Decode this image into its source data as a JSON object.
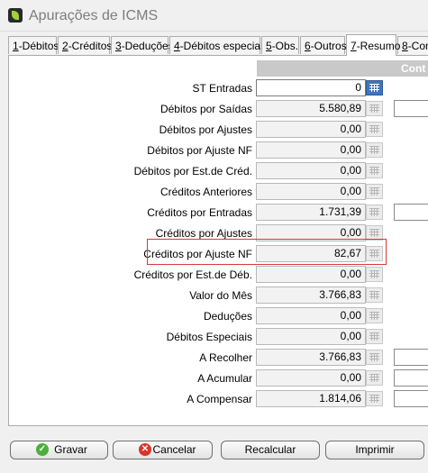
{
  "window": {
    "title": "Apurações de ICMS"
  },
  "tabs": [
    {
      "hotkey": "1",
      "label": "-Débitos"
    },
    {
      "hotkey": "2",
      "label": "-Créditos"
    },
    {
      "hotkey": "3",
      "label": "-Deduções"
    },
    {
      "hotkey": "4",
      "label": "-Débitos especiais"
    },
    {
      "hotkey": "5",
      "label": "-Obs."
    },
    {
      "hotkey": "6",
      "label": "-Outros"
    },
    {
      "hotkey": "7",
      "label": "-Resumo"
    },
    {
      "hotkey": "8",
      "label": "-Con"
    }
  ],
  "active_tab": "7-Resumo",
  "column_header": "Cont",
  "rows": [
    {
      "label": "ST Entradas",
      "value": "0"
    },
    {
      "label": "Débitos por Saídas",
      "value": "5.580,89"
    },
    {
      "label": "Débitos por Ajustes",
      "value": "0,00"
    },
    {
      "label": "Débitos por Ajuste NF",
      "value": "0,00"
    },
    {
      "label": "Débitos por Est.de Créd.",
      "value": "0,00"
    },
    {
      "label": "Créditos Anteriores",
      "value": "0,00"
    },
    {
      "label": "Créditos por Entradas",
      "value": "1.731,39"
    },
    {
      "label": "Créditos por Ajustes",
      "value": "0,00"
    },
    {
      "label": "Créditos por Ajuste NF",
      "value": "82,67"
    },
    {
      "label": "Créditos por Est.de Déb.",
      "value": "0,00"
    },
    {
      "label": "Valor do Mês",
      "value": "3.766,83"
    },
    {
      "label": "Deduções",
      "value": "0,00"
    },
    {
      "label": "Débitos Especiais",
      "value": "0,00"
    },
    {
      "label": "A Recolher",
      "value": "3.766,83"
    },
    {
      "label": "A Acumular",
      "value": "0,00"
    },
    {
      "label": "A Compensar",
      "value": "1.814,06"
    }
  ],
  "buttons": {
    "save": "Gravar",
    "cancel": "Cancelar",
    "recalc": "Recalcular",
    "print": "Imprimir"
  },
  "icons": {
    "app": "app-leaf-icon",
    "save": "check-circle-icon",
    "cancel": "x-circle-icon",
    "calc": "calculator-grid-icon"
  },
  "colors": {
    "highlight": "#d63a3a",
    "save_icon": "#4caf3c",
    "cancel_icon": "#d9342b",
    "active_calc": "#3f76b5"
  }
}
